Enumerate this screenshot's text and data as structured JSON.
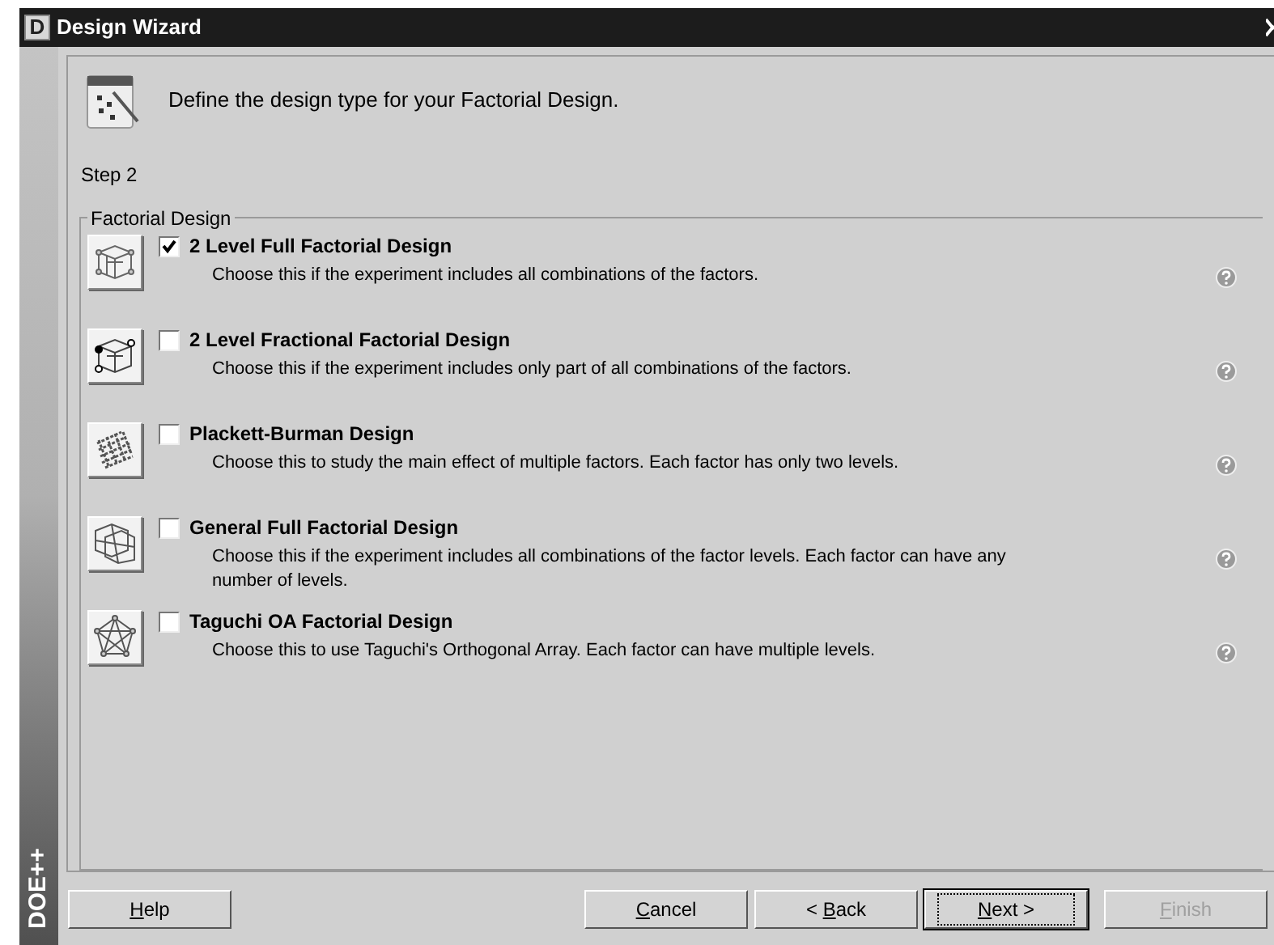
{
  "window": {
    "app_icon_letter": "D",
    "title": "Design Wizard"
  },
  "brand_strip": {
    "text": "DOE++"
  },
  "header": {
    "instruction": "Define the design type for your Factorial Design.",
    "step": "Step 2"
  },
  "group": {
    "title": "Factorial Design",
    "options": [
      {
        "checked": true,
        "title": "2 Level Full Factorial Design",
        "description": "Choose this if the experiment includes all combinations of the factors."
      },
      {
        "checked": false,
        "title": "2 Level Fractional Factorial Design",
        "description": "Choose this if the experiment includes only part of all combinations of the factors."
      },
      {
        "checked": false,
        "title": "Plackett-Burman Design",
        "description": "Choose this to study the main effect of multiple factors. Each factor has only two levels."
      },
      {
        "checked": false,
        "title": "General Full Factorial Design",
        "description": "Choose this if the experiment includes all combinations of the factor levels. Each factor can have any number of levels."
      },
      {
        "checked": false,
        "title": "Taguchi OA Factorial Design",
        "description": "Choose this to use Taguchi's Orthogonal Array. Each factor can have multiple levels."
      }
    ]
  },
  "buttons": [
    {
      "kind": "help",
      "label": "Help",
      "disabled": false,
      "default": false
    },
    {
      "kind": "nav",
      "label": "Cancel",
      "disabled": false,
      "default": false
    },
    {
      "kind": "nav",
      "label": "< Back",
      "disabled": false,
      "default": false
    },
    {
      "kind": "nav",
      "label": "Next >",
      "disabled": false,
      "default": true
    },
    {
      "kind": "finish",
      "label": "Finish",
      "disabled": true,
      "default": false
    }
  ]
}
